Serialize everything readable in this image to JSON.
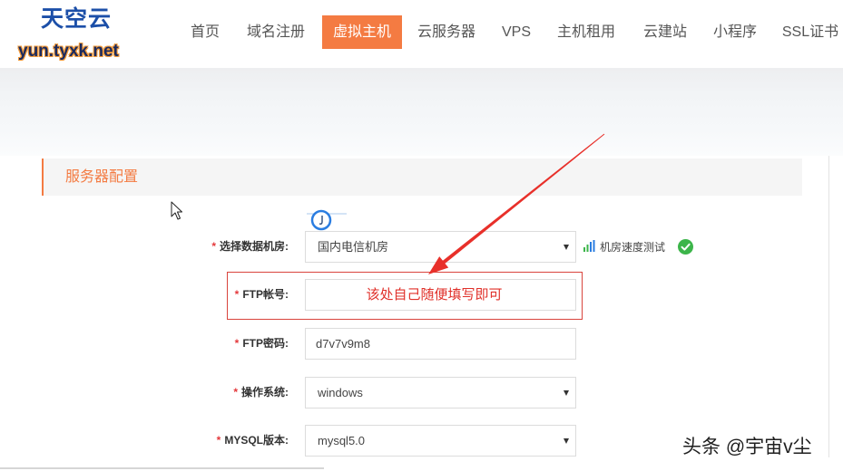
{
  "brand": {
    "name": "天空云",
    "domain": "yun.tyxk.net"
  },
  "nav": {
    "items": [
      {
        "label": "首页"
      },
      {
        "label": "域名注册"
      },
      {
        "label": "虚拟主机",
        "active": true
      },
      {
        "label": "云服务器"
      },
      {
        "label": "VPS"
      },
      {
        "label": "主机租用"
      },
      {
        "label": "云建站"
      },
      {
        "label": "小程序"
      },
      {
        "label": "SSL证书"
      }
    ]
  },
  "section": {
    "title": "服务器配置"
  },
  "form": {
    "required_mark": "*",
    "datacenter": {
      "label": "选择数据机房:",
      "value": "国内电信机房",
      "speed_test_label": "机房速度测试"
    },
    "ftp_account": {
      "label": "FTP帐号:",
      "value": ""
    },
    "ftp_password": {
      "label": "FTP密码:",
      "value": "d7v7v9m8"
    },
    "os": {
      "label": "操作系统:",
      "value": "windows"
    },
    "mysql": {
      "label": "MYSQL版本:",
      "value": "mysql5.0"
    }
  },
  "annotation": {
    "text": "该处自己随便填写即可"
  },
  "watermark": "头条 @宇宙v尘",
  "icons": {
    "select_arrow": "caret-down-icon",
    "speed_test": "signal-bars-icon",
    "datacenter_status": "check-circle-icon",
    "loading": "loading-spinner-icon",
    "pointer": "mouse-pointer-icon"
  },
  "colors": {
    "accent": "#f47b42",
    "required": "#e4393c",
    "annotation": "#e0302a",
    "brand_blue": "#1c4fa8",
    "success": "#3cb54a",
    "nav_text": "#555555"
  }
}
